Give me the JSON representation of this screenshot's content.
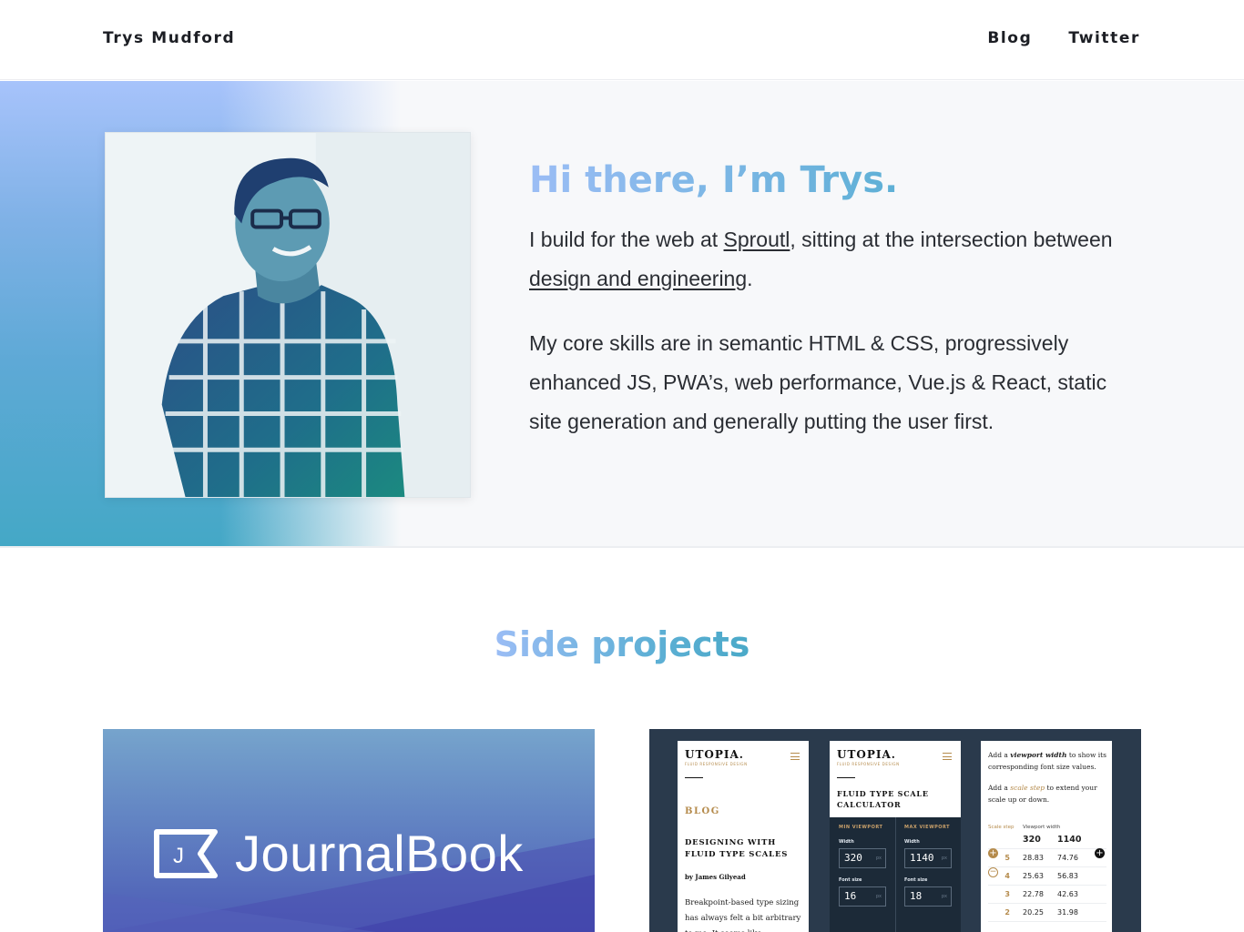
{
  "header": {
    "brand": "Trys Mudford",
    "nav": [
      {
        "label": "Blog"
      },
      {
        "label": "Twitter"
      }
    ]
  },
  "hero": {
    "title": "Hi there, I’m Trys.",
    "p1_before": "I build for the web at ",
    "p1_link1": "Sproutl",
    "p1_middle": ", sitting at the intersection between ",
    "p1_link2": "design and engineering",
    "p1_after": ".",
    "p2": "My core skills are in semantic HTML & CSS, progressively enhanced JS, PWA’s, web performance, Vue.js & React, static site generation and generally putting the user first.",
    "colors": {
      "gradient_top": "#a7c3fb",
      "gradient_bottom": "#44a8c6",
      "title_start": "#9bbdf5",
      "title_end": "#4aa9c8"
    }
  },
  "side_projects": {
    "title": "Side projects",
    "journalbook": {
      "logo_letter": "J",
      "logo_text": "JournalBook"
    },
    "utopia": {
      "logo": "UTOPIA.",
      "tagline": "FLUID RESPONSIVE DESIGN",
      "screen1": {
        "section": "BLOG",
        "post_title": "DESIGNING WITH FLUID TYPE SCALES",
        "byline": "by James Gilyead",
        "body": "Breakpoint-based type sizing has always felt a bit arbitrary to me. It seems like"
      },
      "screen2": {
        "title": "FLUID TYPE SCALE CALCULATOR",
        "min_viewport": "MIN VIEWPORT",
        "max_viewport": "MAX VIEWPORT",
        "width_label": "Width",
        "font_size_label": "Font size",
        "min_width": "320",
        "max_width": "1140",
        "min_font": "16",
        "max_font": "18",
        "unit": "px"
      },
      "screen3": {
        "note1_a": "Add a ",
        "note1_em": "viewport width",
        "note1_b": " to show its corresponding font size values.",
        "note2_a": "Add a ",
        "note2_em": "scale step",
        "note2_b": " to extend your scale up or down.",
        "col_step": "Scale step",
        "col_width": "Viewport width",
        "head_min": "320",
        "head_max": "1140",
        "rows": [
          {
            "step": "5",
            "min": "28.83",
            "max": "74.76"
          },
          {
            "step": "4",
            "min": "25.63",
            "max": "56.83"
          },
          {
            "step": "3",
            "min": "22.78",
            "max": "42.63"
          },
          {
            "step": "2",
            "min": "20.25",
            "max": "31.98"
          }
        ]
      }
    }
  }
}
